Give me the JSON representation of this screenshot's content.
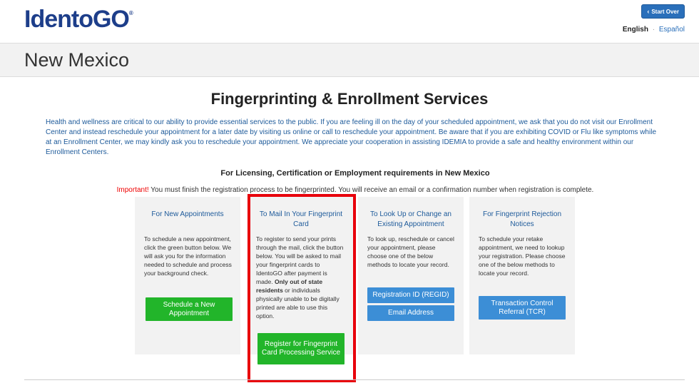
{
  "brand": {
    "logo_text": "IdentoGO",
    "logo_mark": "®"
  },
  "header": {
    "start_over": "Start Over",
    "lang_active": "English",
    "lang_separator": "·",
    "lang_other": "Español",
    "state": "New Mexico"
  },
  "main": {
    "title": "Fingerprinting & Enrollment Services",
    "notice": "Health and wellness are critical to our ability to provide essential services to the public. If you are feeling ill on the day of your scheduled appointment, we ask that you do not visit our Enrollment Center and instead reschedule your appointment for a later date by visiting us online or call to reschedule your appointment. Be aware that if you are exhibiting COVID or Flu like symptoms while at an Enrollment Center, we may kindly ask you to reschedule your appointment. We appreciate your cooperation in assisting IDEMIA to provide a safe and healthy environment within our Enrollment Centers.",
    "requirements_heading": "For Licensing, Certification or Employment requirements in New Mexico",
    "important_label": "Important!",
    "important_text": " You must finish the registration process to be fingerprinted. You will receive an email or a confirmation number when registration is complete."
  },
  "cards": [
    {
      "title": "For New Appointments",
      "body": "To schedule a new appointment, click the green button below. We will ask you for the information needed to schedule and process your background check.",
      "button": "Schedule a New Appointment"
    },
    {
      "title": "To Mail In Your Fingerprint Card",
      "body_pre": "To register to send your prints through the mail, click the button below. You will be asked to mail your fingerprint cards to IdentoGO after payment is made. ",
      "body_bold": "Only out of state residents",
      "body_post": " or individuals physically unable to be digitally printed are able to use this option.",
      "button": "Register for Fingerprint Card Processing Service"
    },
    {
      "title": "To Look Up or Change an Existing Appointment",
      "body": "To look up, reschedule or cancel your appointment, please choose one of the below methods to locate your record.",
      "button_1": "Registration ID (REGID)",
      "button_2": "Email Address"
    },
    {
      "title": "For Fingerprint Rejection Notices",
      "body": "To schedule your retake appointment, we need to lookup your registration. Please choose one of the below methods to locate your record.",
      "button": "Transaction Control Referral (TCR)"
    }
  ],
  "colors": {
    "brand_blue": "#1d3e8a",
    "link_blue": "#1d5a9a",
    "green_button": "#22b52a",
    "blue_button": "#3c8ed6",
    "highlight_red": "#e8000b"
  }
}
